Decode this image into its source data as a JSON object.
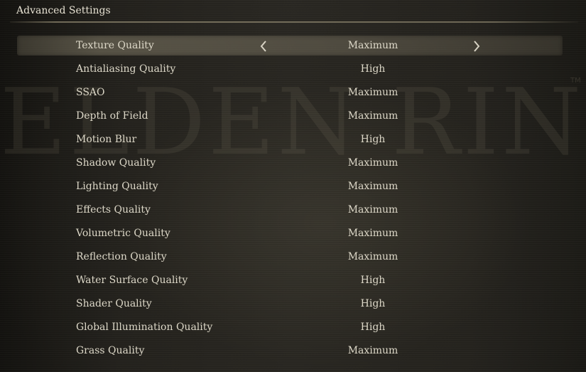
{
  "header": {
    "title": "Advanced Settings"
  },
  "background": {
    "watermark_text": "ELDEN RING",
    "watermark_tm": "TM"
  },
  "arrows": {
    "left_icon": "chevron-left-icon",
    "right_icon": "chevron-right-icon"
  },
  "settings": [
    {
      "label": "Texture Quality",
      "value": "Maximum",
      "selected": true
    },
    {
      "label": "Antialiasing Quality",
      "value": "High"
    },
    {
      "label": "SSAO",
      "value": "Maximum"
    },
    {
      "label": "Depth of Field",
      "value": "Maximum"
    },
    {
      "label": "Motion Blur",
      "value": "High"
    },
    {
      "label": "Shadow Quality",
      "value": "Maximum"
    },
    {
      "label": "Lighting Quality",
      "value": "Maximum"
    },
    {
      "label": "Effects Quality",
      "value": "Maximum"
    },
    {
      "label": "Volumetric Quality",
      "value": "Maximum"
    },
    {
      "label": "Reflection Quality",
      "value": "Maximum"
    },
    {
      "label": "Water Surface Quality",
      "value": "High"
    },
    {
      "label": "Shader Quality",
      "value": "High"
    },
    {
      "label": "Global Illumination Quality",
      "value": "High"
    },
    {
      "label": "Grass Quality",
      "value": "Maximum"
    }
  ]
}
